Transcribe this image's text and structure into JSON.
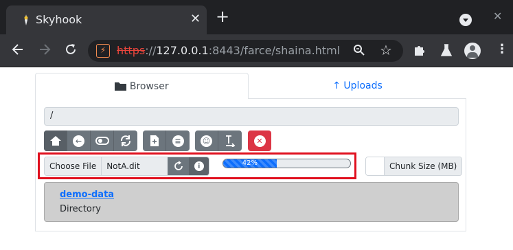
{
  "browser": {
    "tab_title": "Skyhook",
    "tab_close": "✕",
    "new_tab": "+",
    "window_close": "✕",
    "url_scheme": "https",
    "url_sep": "://",
    "url_host": "127.0.0.1",
    "url_rest": ":8443/farce/shaina.html"
  },
  "tabs": {
    "browser_label": "Browser",
    "uploads_label": "↑ Uploads"
  },
  "path": "/",
  "upload": {
    "choose_label": "Choose File",
    "file_name": "NotA.dit",
    "progress_label": "42%",
    "progress_fraction": 0.42,
    "chunk_label": "Chunk Size (MB)",
    "chunk_value": ""
  },
  "listing": {
    "name": "demo-data",
    "type": "Directory"
  },
  "colors": {
    "accent": "#0d6efd",
    "danger": "#dc3545",
    "highlight": "#e0101e",
    "secondary": "#6c757d"
  }
}
